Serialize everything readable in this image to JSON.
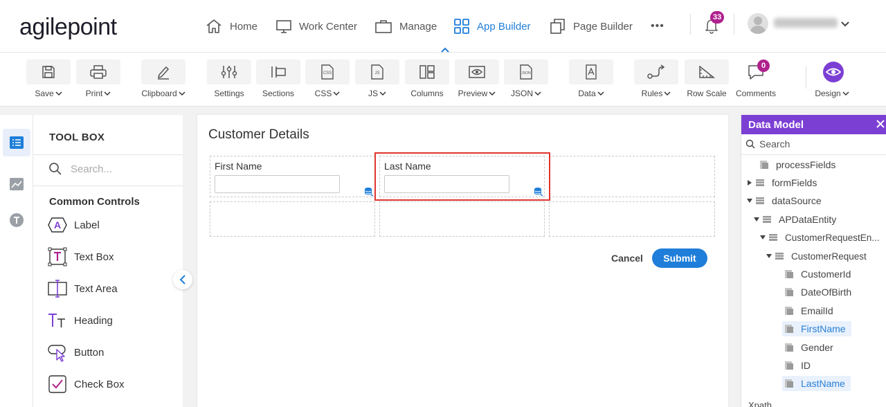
{
  "nav": {
    "logo": "agilepoint",
    "items": [
      {
        "label": "Home",
        "icon": "home-icon"
      },
      {
        "label": "Work Center",
        "icon": "monitor-icon"
      },
      {
        "label": "Manage",
        "icon": "briefcase-icon"
      },
      {
        "label": "App Builder",
        "icon": "grid-icon"
      },
      {
        "label": "Page Builder",
        "icon": "pages-icon"
      }
    ],
    "active": "App Builder",
    "more": "•••",
    "notification_count": "33",
    "accent_color": "#1f7ed9",
    "badge_color": "#b0218e"
  },
  "toolbar": {
    "save": "Save",
    "print": "Print",
    "clipboard": "Clipboard",
    "settings": "Settings",
    "sections": "Sections",
    "css": "CSS",
    "js": "JS",
    "columns": "Columns",
    "preview": "Preview",
    "json": "JSON",
    "data": "Data",
    "rules": "Rules",
    "row_scale": "Row Scale",
    "comments": "Comments",
    "comments_count": "0",
    "design": "Design"
  },
  "toolbox": {
    "title": "TOOL BOX",
    "search_placeholder": "Search...",
    "section": "Common Controls",
    "controls": [
      "Label",
      "Text Box",
      "Text Area",
      "Heading",
      "Button",
      "Check Box"
    ]
  },
  "form": {
    "title": "Customer Details",
    "first_name_label": "First Name",
    "last_name_label": "Last Name",
    "cancel": "Cancel",
    "submit": "Submit"
  },
  "data_model": {
    "title": "Data Model",
    "search_placeholder": "Search",
    "header_color": "#7c3fd4",
    "nodes": [
      "processFields",
      "formFields",
      "dataSource",
      "APDataEntity",
      "CustomerRequestEn...",
      "CustomerRequest",
      "CustomerId",
      "DateOfBirth",
      "EmailId",
      "FirstName",
      "Gender",
      "ID",
      "LastName"
    ],
    "xpath_label": "Xpath"
  }
}
